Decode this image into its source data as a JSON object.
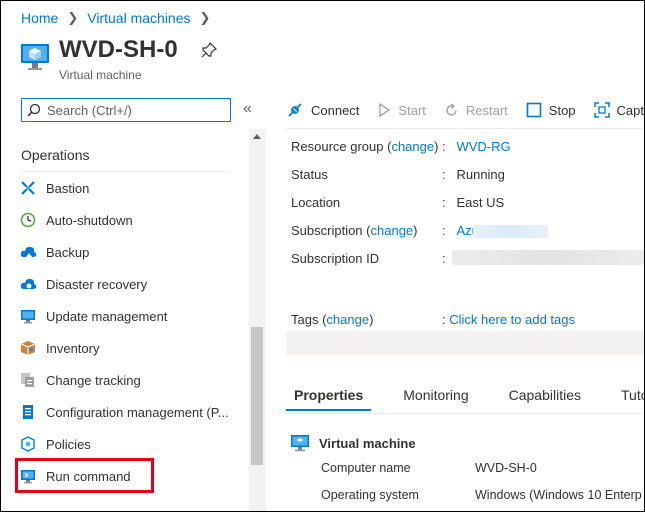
{
  "breadcrumb": {
    "home": "Home",
    "vms": "Virtual machines"
  },
  "header": {
    "title": "WVD-SH-0",
    "subtitle": "Virtual machine"
  },
  "search": {
    "placeholder": "Search (Ctrl+/)"
  },
  "sidebar": {
    "collapse": "«",
    "section": "Operations",
    "items": [
      {
        "label": "Bastion",
        "icon": "bastion-icon"
      },
      {
        "label": "Auto-shutdown",
        "icon": "clock-icon"
      },
      {
        "label": "Backup",
        "icon": "cloud-backup-icon"
      },
      {
        "label": "Disaster recovery",
        "icon": "cloud-recovery-icon"
      },
      {
        "label": "Update management",
        "icon": "monitor-update-icon"
      },
      {
        "label": "Inventory",
        "icon": "box-icon"
      },
      {
        "label": "Change tracking",
        "icon": "change-tracking-icon"
      },
      {
        "label": "Configuration management (P...",
        "icon": "config-icon"
      },
      {
        "label": "Policies",
        "icon": "policies-icon"
      },
      {
        "label": "Run command",
        "icon": "run-command-icon"
      }
    ]
  },
  "toolbar": {
    "connect": "Connect",
    "start": "Start",
    "restart": "Restart",
    "stop": "Stop",
    "capture": "Capt"
  },
  "essentials": {
    "resource_group_label": "Resource group",
    "change": "change",
    "resource_group_value": "WVD-RG",
    "status_label": "Status",
    "status_value": "Running",
    "location_label": "Location",
    "location_value": "East US",
    "subscription_label": "Subscription",
    "subscription_value": "Azu",
    "subscription_id_label": "Subscription ID",
    "tags_label": "Tags",
    "tags_value": "Click here to add tags",
    "colon": ":"
  },
  "tabs": [
    "Properties",
    "Monitoring",
    "Capabilities",
    "Tutorials"
  ],
  "properties": {
    "heading": "Virtual machine",
    "computer_name_label": "Computer name",
    "computer_name_value": "WVD-SH-0",
    "os_label": "Operating system",
    "os_value": "Windows (Windows 10 Enterp"
  },
  "colors": {
    "accent": "#0078d4",
    "highlight": "#e3001b"
  }
}
